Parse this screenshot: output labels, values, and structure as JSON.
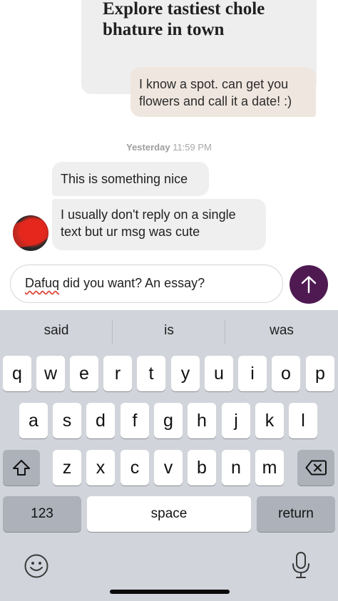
{
  "chat": {
    "prompt_card": {
      "text": "Explore tastiest chole bhature in town"
    },
    "outgoing_message": "I know a spot. can get you flowers and call it a date! :)",
    "timestamp": {
      "day": "Yesterday",
      "time": "11:59 PM"
    },
    "incoming_messages": [
      "This is something nice",
      "I usually don't reply on a single text but ur msg was cute"
    ]
  },
  "composer": {
    "misspelled_word": "Dafuq",
    "rest_text": " did you want? An essay?",
    "send_icon": "arrow-up-icon"
  },
  "keyboard": {
    "suggestions": [
      "said",
      "is",
      "was"
    ],
    "row1": [
      "q",
      "w",
      "e",
      "r",
      "t",
      "y",
      "u",
      "i",
      "o",
      "p"
    ],
    "row2": [
      "a",
      "s",
      "d",
      "f",
      "g",
      "h",
      "j",
      "k",
      "l"
    ],
    "row3": [
      "z",
      "x",
      "c",
      "v",
      "b",
      "n",
      "m"
    ],
    "shift_icon": "shift-icon",
    "delete_icon": "backspace-icon",
    "numbers_label": "123",
    "space_label": "space",
    "return_label": "return",
    "emoji_icon": "emoji-icon",
    "mic_icon": "microphone-icon"
  },
  "colors": {
    "send_button": "#4f1a52",
    "outgoing_bubble": "#efe7df",
    "incoming_bubble": "#efefef",
    "keyboard_bg": "#d1d4da"
  }
}
